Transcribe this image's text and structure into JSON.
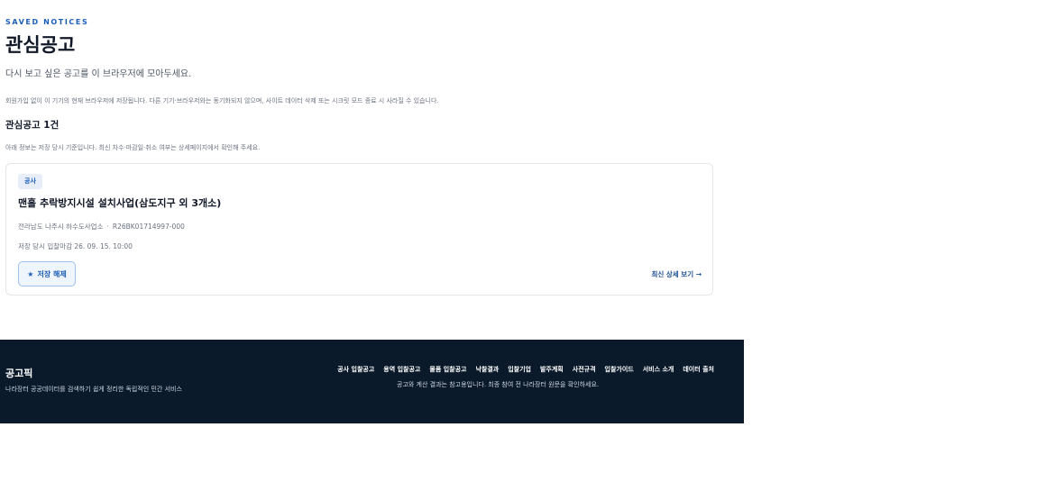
{
  "header": {
    "eyebrow": "SAVED NOTICES",
    "title": "관심공고",
    "subtitle": "다시 보고 싶은 공고를 이 브라우저에 모아두세요.",
    "notice": "회원가입 없이 이 기기의 현재 브라우저에 저장됩니다. 다른 기기·브라우저와는 동기화되지 않으며, 사이트 데이터 삭제 또는 시크릿 모드 종료 시 사라질 수 있습니다."
  },
  "summary": {
    "count_label": "관심공고 1건",
    "basis_note": "아래 정보는 저장 당시 기준입니다. 최신 차수·마감일·취소 여부는 상세페이지에서 확인해 주세요."
  },
  "items": [
    {
      "category": "공사",
      "title": "맨홀 추락방지시설 설치사업(삼도지구 외 3개소)",
      "agency": "전라남도 나주시 하수도사업소",
      "notice_no": "R26BK01714997-000",
      "deadline": "저장 당시 입찰마감 26. 09. 15. 10:00",
      "unsave_label": "저장 해제",
      "unsave_icon": "★",
      "detail_link": "최신 상세 보기 →"
    }
  ],
  "footer": {
    "brand": "공고픽",
    "tagline": "나라장터 공공데이터를 검색하기 쉽게 정리한 독립적인 민간 서비스",
    "nav": [
      "공사 입찰공고",
      "용역 입찰공고",
      "물품 입찰공고",
      "낙찰결과",
      "입찰기업",
      "발주계획",
      "사전규격",
      "입찰가이드",
      "서비스 소개",
      "데이터 출처"
    ],
    "disclaimer": "공고와 계산 결과는 참고용입니다. 최종 참여 전 나라장터 원문을 확인하세요."
  },
  "colors": {
    "accent": "#1d5fb8",
    "footer_bg": "#0b1a2b",
    "badge_bg": "#e7eefa"
  }
}
